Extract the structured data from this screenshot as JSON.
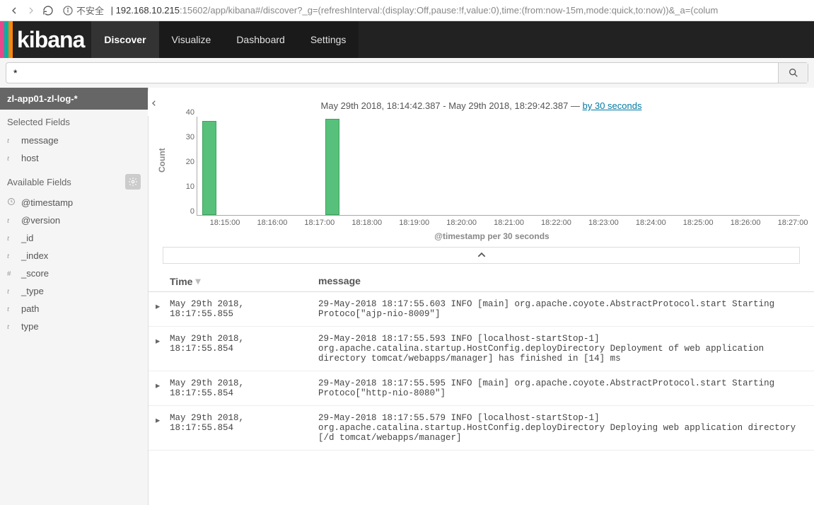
{
  "browser": {
    "insecure_label": "不安全",
    "url_host": "192.168.10.215",
    "url_port": ":15602",
    "url_path": "/app/kibana#/discover?_g=(refreshInterval:(display:Off,pause:!f,value:0),time:(from:now-15m,mode:quick,to:now))&_a=(colum"
  },
  "brand": {
    "name": "kibana",
    "stripes": [
      "#e8478b",
      "#00b3a4",
      "#f98510",
      "#333"
    ]
  },
  "nav": {
    "items": [
      "Discover",
      "Visualize",
      "Dashboard",
      "Settings"
    ],
    "active": "Discover"
  },
  "search": {
    "query": "*"
  },
  "sidebar": {
    "index_pattern": "zl-app01-zl-log-*",
    "selected_title": "Selected Fields",
    "selected_fields": [
      {
        "type": "t",
        "name": "message"
      },
      {
        "type": "t",
        "name": "host"
      }
    ],
    "available_title": "Available Fields",
    "available_fields": [
      {
        "type": "clock",
        "name": "@timestamp"
      },
      {
        "type": "t",
        "name": "@version"
      },
      {
        "type": "t",
        "name": "_id"
      },
      {
        "type": "t",
        "name": "_index"
      },
      {
        "type": "hash",
        "name": "_score"
      },
      {
        "type": "t",
        "name": "_type"
      },
      {
        "type": "t",
        "name": "path"
      },
      {
        "type": "t",
        "name": "type"
      }
    ]
  },
  "timepicker": {
    "from": "May 29th 2018, 18:14:42.387",
    "to": "May 29th 2018, 18:29:42.387",
    "interval_label": "by 30 seconds"
  },
  "chart_data": {
    "type": "bar",
    "ylabel": "Count",
    "xlabel": "@timestamp per 30 seconds",
    "ylim": [
      0,
      40
    ],
    "y_ticks": [
      0,
      10,
      20,
      30,
      40
    ],
    "x_ticks": [
      "18:15:00",
      "18:16:00",
      "18:17:00",
      "18:18:00",
      "18:19:00",
      "18:20:00",
      "18:21:00",
      "18:22:00",
      "18:23:00",
      "18:24:00",
      "18:25:00",
      "18:26:00",
      "18:27:00"
    ],
    "bars": [
      {
        "x": "18:14:45",
        "value": 38
      },
      {
        "x": "18:17:45",
        "value": 39
      }
    ]
  },
  "table": {
    "headers": {
      "time": "Time",
      "message": "message"
    },
    "rows": [
      {
        "time": "May 29th 2018, 18:17:55.855",
        "message": "29-May-2018 18:17:55.603 INFO [main] org.apache.coyote.AbstractProtocol.start Starting Protoco[\"ajp-nio-8009\"]"
      },
      {
        "time": "May 29th 2018, 18:17:55.854",
        "message": "29-May-2018 18:17:55.593 INFO [localhost-startStop-1] org.apache.catalina.startup.HostConfig.deployDirectory Deployment of web application directory tomcat/webapps/manager] has finished in [14] ms"
      },
      {
        "time": "May 29th 2018, 18:17:55.854",
        "message": "29-May-2018 18:17:55.595 INFO [main] org.apache.coyote.AbstractProtocol.start Starting Protoco[\"http-nio-8080\"]"
      },
      {
        "time": "May 29th 2018, 18:17:55.854",
        "message": "29-May-2018 18:17:55.579 INFO [localhost-startStop-1] org.apache.catalina.startup.HostConfig.deployDirectory Deploying web application directory [/d tomcat/webapps/manager]"
      }
    ]
  }
}
